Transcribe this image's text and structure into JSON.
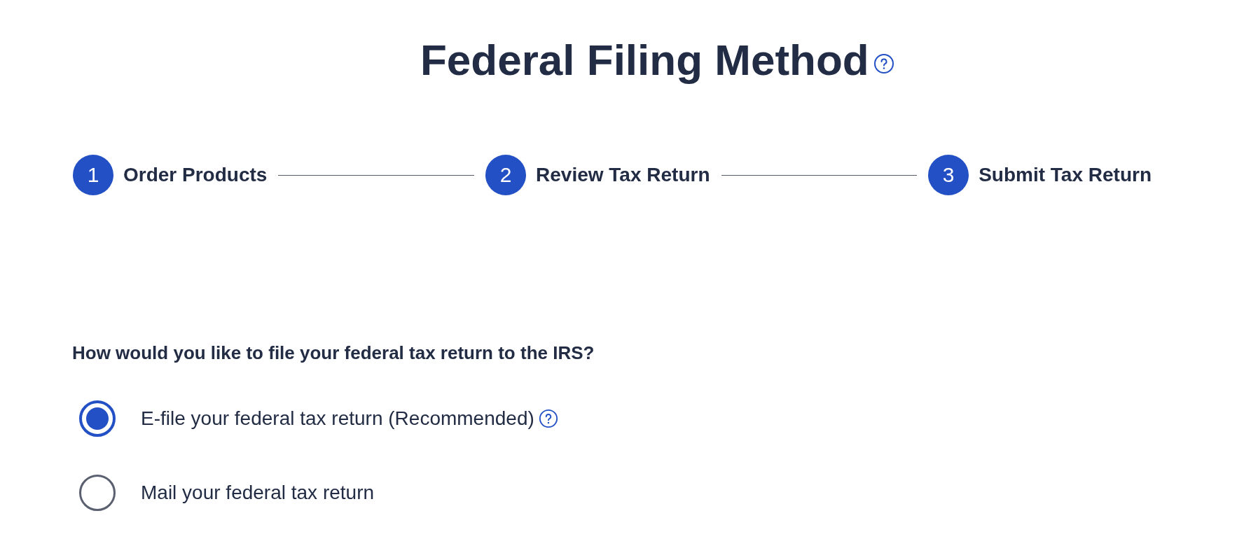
{
  "title": "Federal Filing Method",
  "steps": [
    {
      "number": "1",
      "label": "Order Products"
    },
    {
      "number": "2",
      "label": "Review Tax Return"
    },
    {
      "number": "3",
      "label": "Submit Tax Return"
    }
  ],
  "question": "How would you like to file your federal tax return to the IRS?",
  "options": [
    {
      "label": "E-file your federal tax return (Recommended)",
      "selected": true,
      "help": true
    },
    {
      "label": "Mail your federal tax return",
      "selected": false,
      "help": false
    }
  ]
}
